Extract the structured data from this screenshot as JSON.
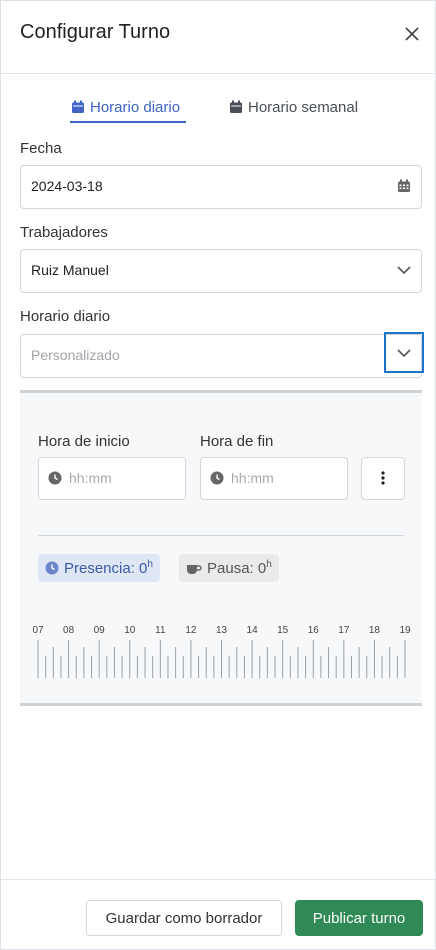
{
  "header": {
    "title": "Configurar Turno",
    "close_icon": "close-icon"
  },
  "tabs": [
    {
      "label": "Horario diario",
      "icon": "calendar-icon",
      "active": true
    },
    {
      "label": "Horario semanal",
      "icon": "calendar-icon",
      "active": false
    }
  ],
  "form": {
    "date": {
      "label": "Fecha",
      "value": "2024-03-18",
      "icon": "calendar-icon"
    },
    "workers": {
      "label": "Trabajadores",
      "value": "Ruiz Manuel"
    },
    "daily_schedule": {
      "label": "Horario diario",
      "placeholder": "Personalizado"
    }
  },
  "schedule": {
    "start": {
      "label": "Hora de inicio",
      "placeholder": "hh:mm"
    },
    "end": {
      "label": "Hora de fin",
      "placeholder": "hh:mm"
    },
    "presence": {
      "label": "Presencia: 0",
      "unit": "h"
    },
    "pause": {
      "label": "Pausa: 0",
      "unit": "h"
    },
    "timeline_hours": [
      "07",
      "08",
      "09",
      "10",
      "11",
      "12",
      "13",
      "14",
      "15",
      "16",
      "17",
      "18",
      "19"
    ]
  },
  "footer": {
    "draft_label": "Guardar como borrador",
    "publish_label": "Publicar turno"
  },
  "colors": {
    "accent": "#3f64c4",
    "primary": "#2f8a55",
    "focus": "#1a73c8"
  }
}
